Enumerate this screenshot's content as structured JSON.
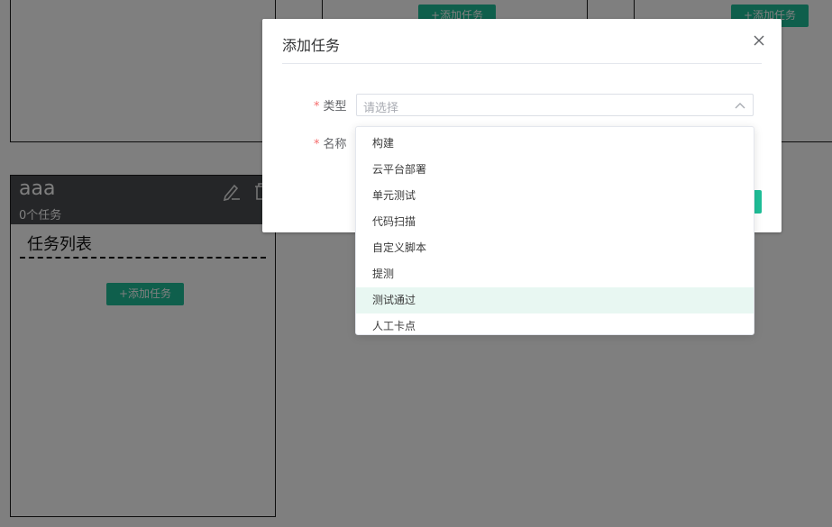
{
  "columns": {
    "add_task_label": "+添加任务",
    "stage_card": {
      "title": "aaa",
      "task_count": "0个任务",
      "task_list_title": "任务列表",
      "add_task_label": "+添加任务"
    }
  },
  "dialog": {
    "title": "添加任务",
    "type_label": "类型",
    "name_label": "名称",
    "required_mark": "*",
    "type_placeholder": "请选择"
  },
  "dropdown": {
    "options": [
      "构建",
      "云平台部署",
      "单元测试",
      "代码扫描",
      "自定义脚本",
      "提测",
      "测试通过",
      "人工卡点"
    ],
    "highlighted": "测试通过"
  },
  "icons": {
    "edit": "pencil-icon",
    "delete": "trash-icon",
    "close": "close-icon",
    "select_arrow": "chevron-up-icon"
  },
  "colors": {
    "accent": "#1fbf98",
    "card_header": "#4a4d51",
    "highlight_bg": "#e8f7f2",
    "required": "#f56c6c"
  }
}
